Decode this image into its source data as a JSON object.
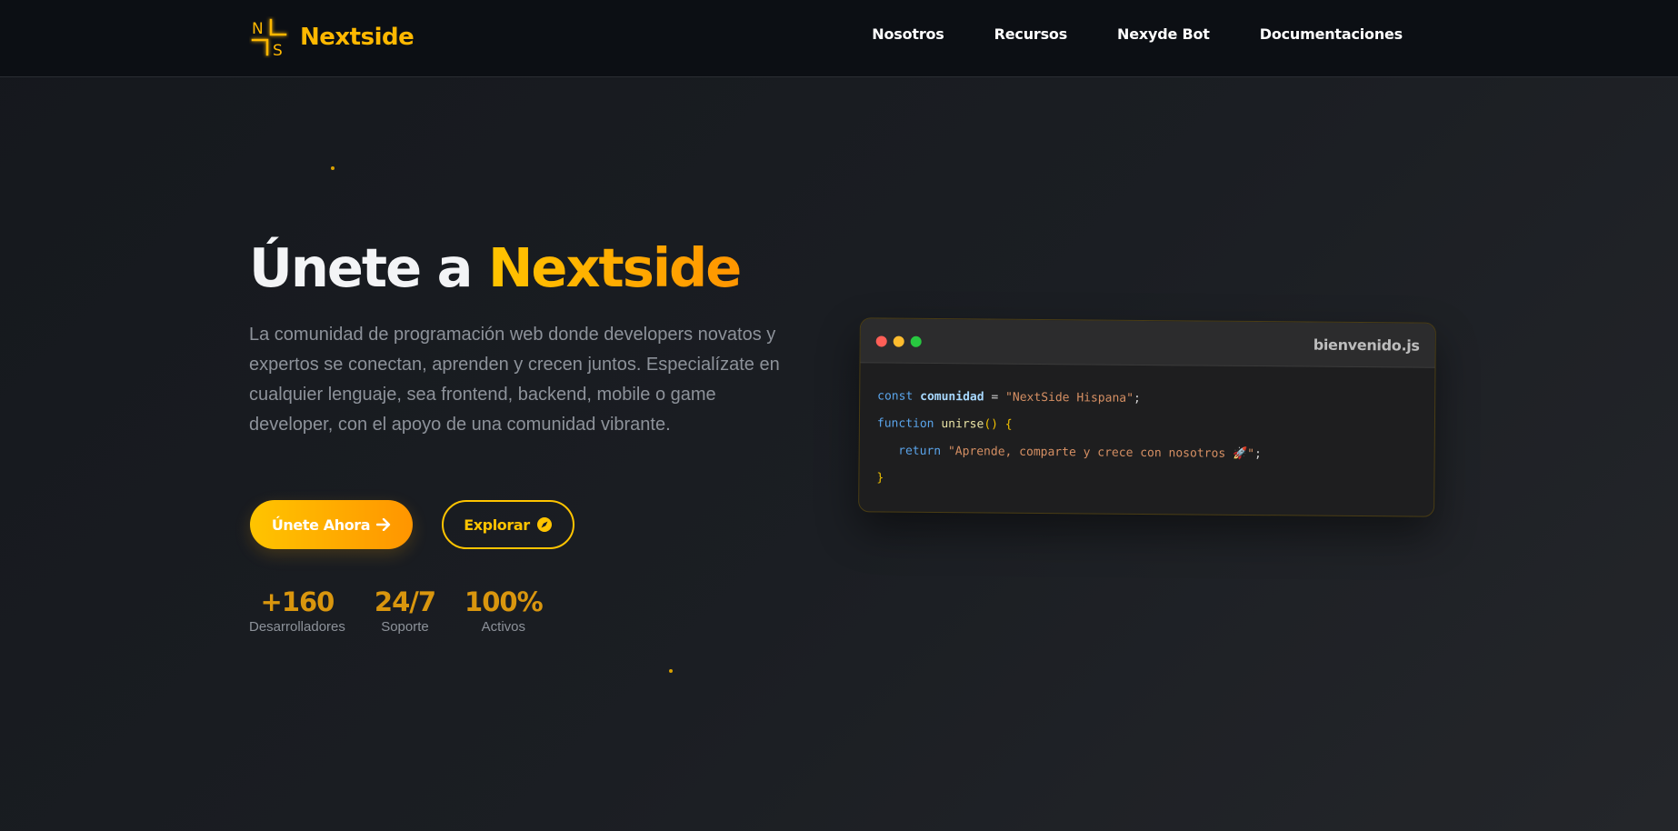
{
  "brand": {
    "name": "Nextside",
    "logo_letters": [
      "N",
      "S"
    ]
  },
  "nav": {
    "items": [
      {
        "label": "Nosotros"
      },
      {
        "label": "Recursos"
      },
      {
        "label": "Nexyde Bot"
      },
      {
        "label": "Documentaciones"
      }
    ]
  },
  "hero": {
    "title_prefix": "Únete a",
    "title_accent": "Nextside",
    "description": "La comunidad de programación web donde developers novatos y expertos se conectan, aprenden y crecen juntos. Especialízate en cualquier lenguaje, sea frontend, backend, mobile o game developer, con el apoyo de una comunidad vibrante.",
    "primary_button": "Únete Ahora",
    "secondary_button": "Explorar"
  },
  "stats": [
    {
      "value": "+160",
      "label": "Desarrolladores"
    },
    {
      "value": "24/7",
      "label": "Soporte"
    },
    {
      "value": "100%",
      "label": "Activos"
    }
  ],
  "code_window": {
    "filename": "bienvenido.js",
    "line1": {
      "kw": "const",
      "var": "comunidad",
      "op": " = ",
      "str": "\"NextSide Hispana\"",
      "end": ";"
    },
    "line2": {
      "kw": "function",
      "fn": "unirse",
      "paren": "()",
      "brace": "{"
    },
    "line3": {
      "kw": "return",
      "str": "\"Aprende, comparte y crece con nosotros 🚀\"",
      "end": ";"
    },
    "line4": {
      "brace": "}"
    }
  },
  "colors": {
    "accent": "#ffb800",
    "accent_gradient_start": "#ffc400",
    "accent_gradient_end": "#ff9500",
    "background": "#1b1e23",
    "traffic_red": "#ff5f57",
    "traffic_yellow": "#febc2e",
    "traffic_green": "#28c840"
  },
  "icons": {
    "primary_button": "arrow-right-icon",
    "secondary_button": "compass-icon"
  }
}
